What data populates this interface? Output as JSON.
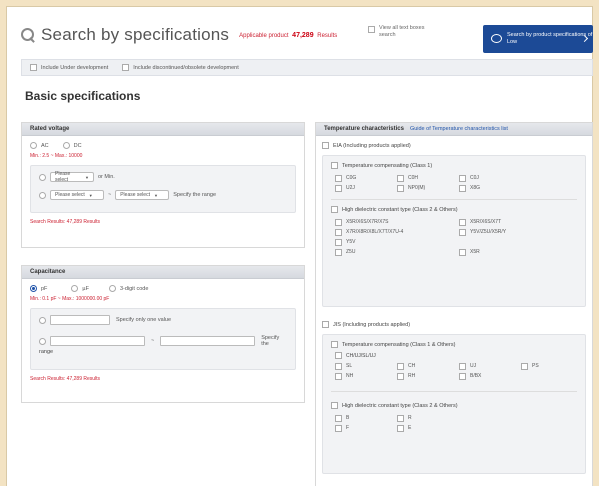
{
  "header": {
    "title": "Search by specifications",
    "count_prefix": "Applicable product",
    "count_value": "47,289",
    "count_suffix": "Results",
    "view_all_label": "View all text boxes search",
    "search_button": "Search by product specifications of Low"
  },
  "filters": {
    "opt1": "Include Under development",
    "opt2": "Include discontinued/obsolete development"
  },
  "basic_title": "Basic specifications",
  "rated_voltage": {
    "title": "Rated voltage",
    "radio1": "AC",
    "radio2": "DC",
    "range_note": "Min.: 2.5 ~ Max.: 10000",
    "select_placeholder": "Please select",
    "min_label": "or Min.",
    "to": "~",
    "range_label": "Specify the range",
    "result": "Search Results: 47,289 Results"
  },
  "capacitance": {
    "title": "Capacitance",
    "radio1": "pF",
    "radio2": "µF",
    "radio3": "3-digit code",
    "range_note": "Min.: 0.1 pF ~ Max.: 1000000.00 pF",
    "single_label": "Specify only one value",
    "to": "~",
    "range_label": "Specify the",
    "range_label2": "range",
    "result": "Search Results: 47,289 Results"
  },
  "temp": {
    "title": "Temperature characteristics",
    "link": "Guide of Temperature characteristics list",
    "class1_label": "EIA (Including products applied)",
    "comp_label": "Temperature compensating (Class 1)",
    "comp_items": [
      "C0G",
      "C0H",
      "C0J",
      "U2J",
      "NP0(M)",
      "X8G"
    ],
    "high_label": "High dielectric constant type (Class 2 & Others)",
    "high_items": [
      "X5R/X6S/X7R/X7S",
      "X5R/X6S/X7T",
      "X7R/X8R/X8L/X7T/X7U-4",
      "Y5V/Z5U/X5R/Y",
      "Y5V",
      "Z5U",
      "X5R"
    ],
    "jis_label": "JIS (Including products applied)",
    "jis_comp_label": "Temperature compensating (Class 1 & Others)",
    "jis_comp_sub": "CH/UJ/SL/UJ",
    "jis_comp_items": [
      "SL",
      "CH",
      "UJ",
      "PS",
      "NH",
      "RH",
      "B/BX"
    ],
    "jis_high_label": "High dielectric constant type (Class 2 & Others)",
    "jis_high_items": [
      "B",
      "R",
      "F",
      "E"
    ]
  }
}
